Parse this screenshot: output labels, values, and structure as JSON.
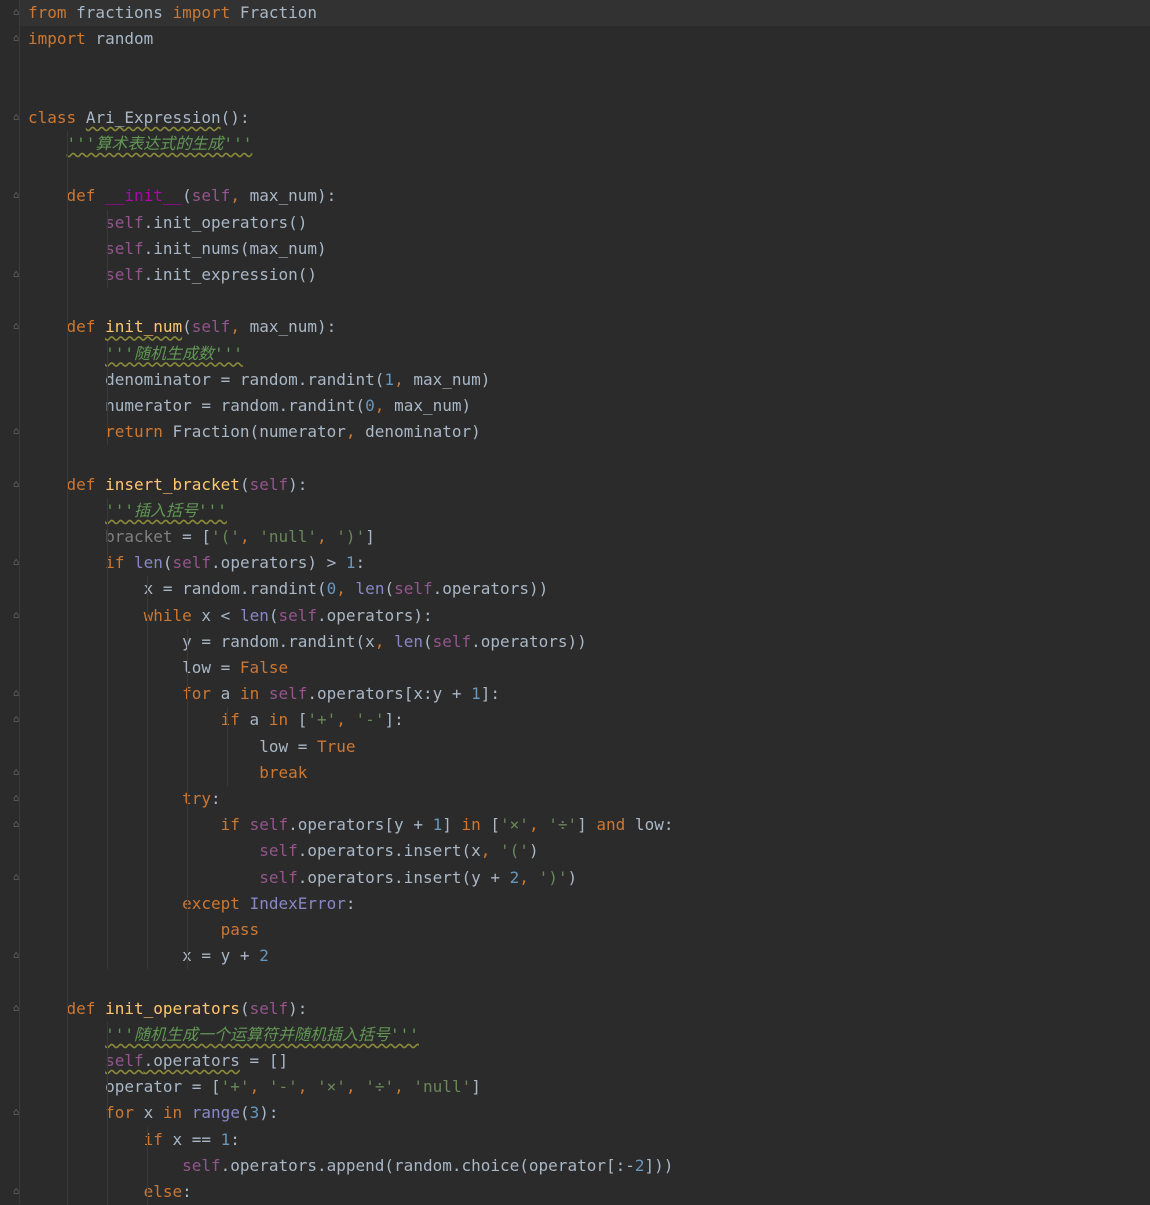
{
  "editor": {
    "lines": [
      "from fractions import Fraction",
      "import random",
      "",
      "",
      "class Ari_Expression():",
      "    '''算术表达式的生成'''",
      "",
      "    def __init__(self, max_num):",
      "        self.init_operators()",
      "        self.init_nums(max_num)",
      "        self.init_expression()",
      "",
      "    def init_num(self, max_num):",
      "        '''随机生成数'''",
      "        denominator = random.randint(1, max_num)",
      "        numerator = random.randint(0, max_num)",
      "        return Fraction(numerator, denominator)",
      "",
      "    def insert_bracket(self):",
      "        '''插入括号'''",
      "        bracket = ['(', 'null', ')']",
      "        if len(self.operators) > 1:",
      "            x = random.randint(0, len(self.operators))",
      "            while x < len(self.operators):",
      "                y = random.randint(x, len(self.operators))",
      "                low = False",
      "                for a in self.operators[x:y + 1]:",
      "                    if a in ['+', '-']:",
      "                        low = True",
      "                        break",
      "                try:",
      "                    if self.operators[y + 1] in ['×', '÷'] and low:",
      "                        self.operators.insert(x, '(')",
      "                        self.operators.insert(y + 2, ')')",
      "                except IndexError:",
      "                    pass",
      "                x = y + 2",
      "",
      "    def init_operators(self):",
      "        '''随机生成一个运算符并随机插入括号'''",
      "        self.operators = []",
      "        operator = ['+', '-', '×', '÷', 'null']",
      "        for x in range(3):",
      "            if x == 1:",
      "                self.operators.append(random.choice(operator[:-2]))",
      "            else:"
    ]
  }
}
